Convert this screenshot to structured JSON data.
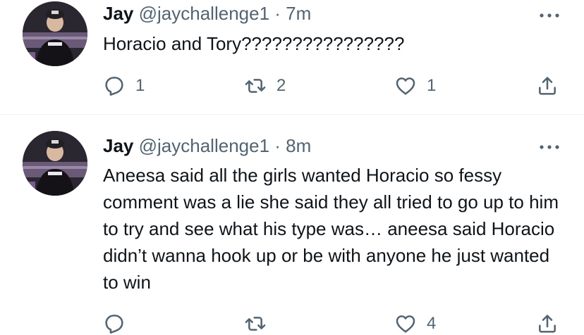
{
  "tweets": [
    {
      "name": "Jay",
      "handle": "@jaychallenge1",
      "separator": "·",
      "time": "7m",
      "text": "Horacio and Tory????????????????",
      "replies": "1",
      "retweets": "2",
      "likes": "1"
    },
    {
      "name": "Jay",
      "handle": "@jaychallenge1",
      "separator": "·",
      "time": "8m",
      "text": "Aneesa said all the girls wanted Horacio so fessy comment was a lie she said they all tried to go up to him to try and see what his type was… aneesa said Horacio didn’t wanna hook up or be with anyone he just wanted to win",
      "replies": "",
      "retweets": "",
      "likes": "4"
    }
  ],
  "colors": {
    "text": "#0f1419",
    "secondary": "#536471",
    "divider": "#eff3f4"
  }
}
